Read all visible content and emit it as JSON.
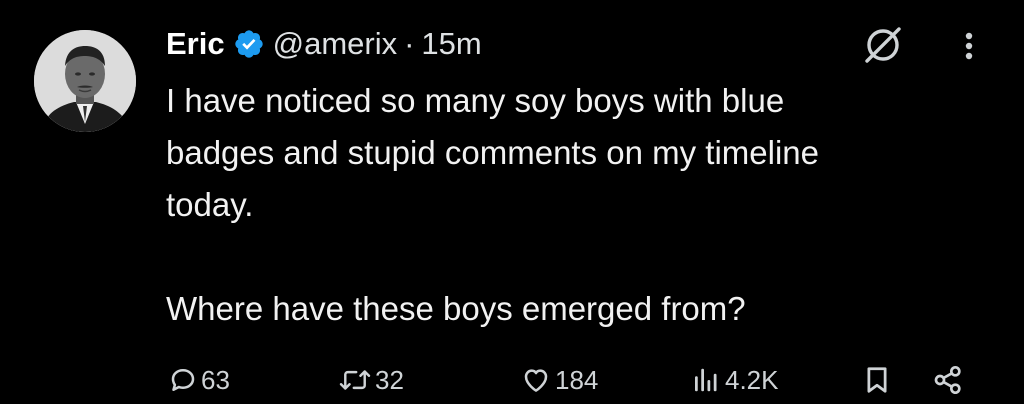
{
  "author": {
    "display_name": "Eric",
    "handle": "@amerix",
    "separator": "·",
    "timestamp": "15m",
    "verified": true,
    "verified_color": "#1d9bf0"
  },
  "tweet": {
    "text": "I have noticed so many soy boys with blue\nbadges and stupid comments on my timeline\ntoday.\n\nWhere have these boys emerged from?"
  },
  "actions": {
    "replies": "63",
    "retweets": "32",
    "likes": "184",
    "views": "4.2K"
  },
  "icons": {
    "avatar": "profile-photo",
    "verified": "verified-badge-icon",
    "grok": "grok-icon",
    "more": "more-options-icon",
    "reply": "reply-icon",
    "retweet": "retweet-icon",
    "like": "heart-icon",
    "views": "views-chart-icon",
    "bookmark": "bookmark-icon",
    "share": "share-icon"
  },
  "colors": {
    "background": "#000000",
    "text": "#e7e9ea",
    "secondary": "#cfd3d6",
    "accent": "#1d9bf0"
  }
}
